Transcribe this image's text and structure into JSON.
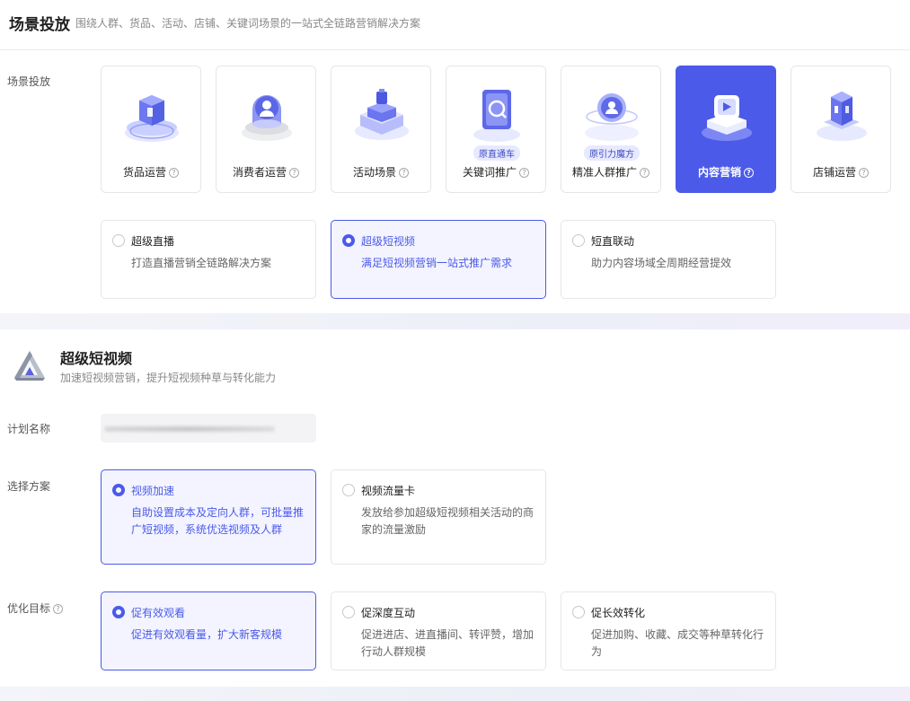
{
  "header": {
    "title": "场景投放",
    "subtitle": "围绕人群、货品、活动、店铺、关键词场景的一站式全链路营销解决方案"
  },
  "scene": {
    "row_label": "场景投放",
    "cards": [
      {
        "label": "货品运营",
        "icon": "product-ops-icon"
      },
      {
        "label": "消费者运营",
        "icon": "consumer-ops-icon"
      },
      {
        "label": "活动场景",
        "icon": "activity-scene-icon"
      },
      {
        "label": "关键词推广",
        "icon": "keyword-promo-icon",
        "badge": "原直通车"
      },
      {
        "label": "精准人群推广",
        "icon": "audience-promo-icon",
        "badge": "原引力魔方"
      },
      {
        "label": "内容营销",
        "icon": "content-marketing-icon",
        "active": true
      },
      {
        "label": "店铺运营",
        "icon": "store-ops-icon"
      }
    ],
    "sub_options": [
      {
        "title": "超级直播",
        "desc": "打造直播营销全链路解决方案"
      },
      {
        "title": "超级短视频",
        "desc": "满足短视频营销一站式推广需求",
        "selected": true
      },
      {
        "title": "短直联动",
        "desc": "助力内容场域全周期经营提效"
      }
    ]
  },
  "section": {
    "title": "超级短视频",
    "subtitle": "加速短视频营销，提升短视频种草与转化能力",
    "logo": "short-video-logo"
  },
  "plan": {
    "label": "计划名称"
  },
  "scheme": {
    "label": "选择方案",
    "options": [
      {
        "title": "视频加速",
        "desc_line1": "自助设置成本及定向人群，可批量推",
        "desc_line2": "广短视频，系统优选视频及人群",
        "selected": true
      },
      {
        "title": "视频流量卡",
        "desc_line1": "发放给参加超级短视频相关活动的商",
        "desc_line2": "家的流量激励"
      }
    ]
  },
  "goal": {
    "label": "优化目标",
    "options": [
      {
        "title": "促有效观看",
        "desc_line1": "促进有效观看量，扩大新客规模",
        "desc_line2": "",
        "selected": true
      },
      {
        "title": "促深度互动",
        "desc_line1": "促进进店、进直播间、转评赞，增加",
        "desc_line2": "行动人群规模"
      },
      {
        "title": "促长效转化",
        "desc_line1": "促进加购、收藏、成交等种草转化行",
        "desc_line2": "为"
      }
    ]
  },
  "colors": {
    "accent": "#4b5ae8",
    "accent_bg": "#f3f4ff",
    "border": "#e6e6e6"
  }
}
